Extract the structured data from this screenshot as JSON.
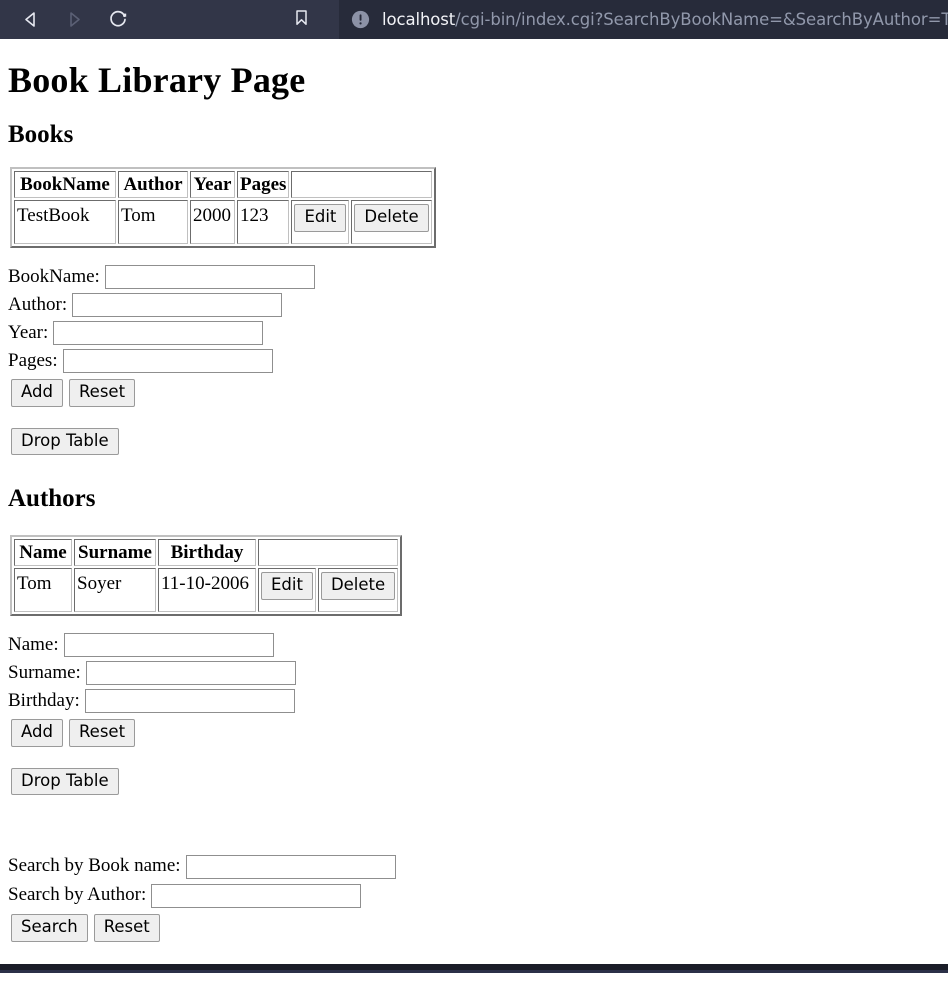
{
  "browser": {
    "back_icon": "back-arrow-icon",
    "forward_icon": "forward-arrow-icon",
    "reload_icon": "reload-icon",
    "bookmark_icon": "bookmark-icon",
    "security_icon": "not-secure-info-icon",
    "url_host": "localhost",
    "url_rest": "/cgi-bin/index.cgi?SearchByBookName=&SearchByAuthor=Tom",
    "toolbar_bg": "#323648",
    "urlbar_bg": "#272b3a"
  },
  "page": {
    "title": "Book Library Page"
  },
  "books": {
    "heading": "Books",
    "columns": [
      "BookName",
      "Author",
      "Year",
      "Pages"
    ],
    "rows": [
      {
        "bookname": "TestBook",
        "author": "Tom",
        "year": "2000",
        "pages": "123",
        "edit_label": "Edit",
        "delete_label": "Delete"
      }
    ],
    "form": {
      "fields": [
        {
          "label": "BookName:",
          "value": "",
          "placeholder": ""
        },
        {
          "label": "Author:",
          "value": "",
          "placeholder": ""
        },
        {
          "label": "Year:",
          "value": "",
          "placeholder": ""
        },
        {
          "label": "Pages:",
          "value": "",
          "placeholder": ""
        }
      ],
      "add_label": "Add",
      "reset_label": "Reset"
    },
    "drop_table_label": "Drop Table"
  },
  "authors": {
    "heading": "Authors",
    "columns": [
      "Name",
      "Surname",
      "Birthday"
    ],
    "rows": [
      {
        "name": "Tom",
        "surname": "Soyer",
        "birthday": "11-10-2006",
        "edit_label": "Edit",
        "delete_label": "Delete"
      }
    ],
    "form": {
      "fields": [
        {
          "label": "Name:",
          "value": "",
          "placeholder": ""
        },
        {
          "label": "Surname:",
          "value": "",
          "placeholder": ""
        },
        {
          "label": "Birthday:",
          "value": "",
          "placeholder": ""
        }
      ],
      "add_label": "Add",
      "reset_label": "Reset"
    },
    "drop_table_label": "Drop Table"
  },
  "search": {
    "book_label": "Search by Book name:",
    "book_value": "",
    "author_label": "Search by Author:",
    "author_value": "",
    "search_label": "Search",
    "reset_label": "Reset"
  }
}
